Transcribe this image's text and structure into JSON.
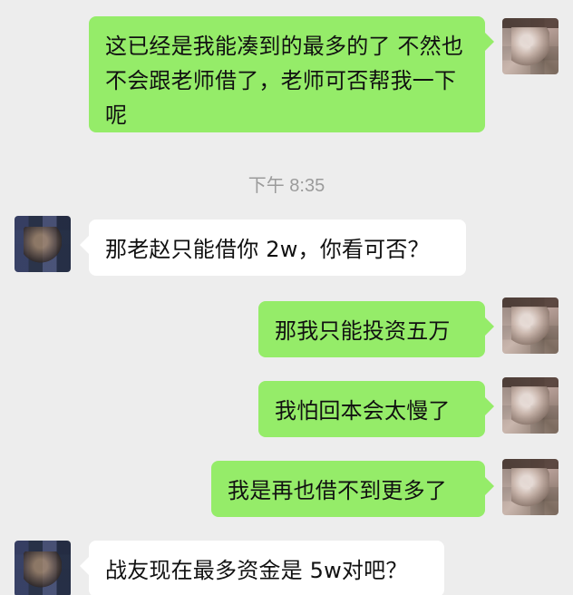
{
  "chat": {
    "messages": [
      {
        "side": "right",
        "text": "这已经是我能凑到的最多的了 不然也不会跟老师借了，老师可否帮我一下呢"
      },
      {
        "timestamp": "下午 8:35"
      },
      {
        "side": "left",
        "text": "那老赵只能借你 2w，你看可否？"
      },
      {
        "side": "right",
        "text": "那我只能投资五万"
      },
      {
        "side": "right",
        "text": "我怕回本会太慢了"
      },
      {
        "side": "right",
        "text": "我是再也借不到更多了"
      },
      {
        "side": "left",
        "text": "战友现在最多资金是 5w对吧？"
      }
    ]
  },
  "colors": {
    "background": "#ededed",
    "right_bubble": "#95ec69",
    "left_bubble": "#ffffff",
    "timestamp_text": "#9b9b9b"
  }
}
